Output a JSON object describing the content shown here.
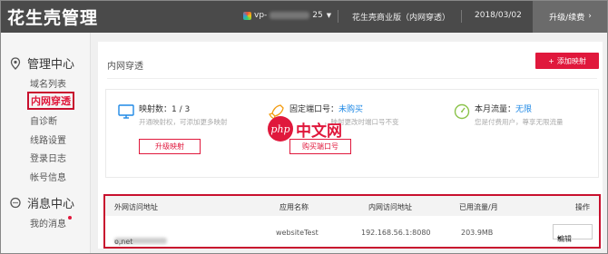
{
  "app": {
    "title": "花生壳管理"
  },
  "topbar": {
    "host_prefix": "vp-",
    "host_suffix": "25",
    "edition": "花生壳商业版（内网穿透）",
    "date": "2018/03/02",
    "renew_label": "升级/续费"
  },
  "sidebar": {
    "sections": [
      {
        "title": "管理中心",
        "items": [
          "域名列表",
          "内网穿透",
          "自诊断",
          "线路设置",
          "登录日志",
          "帐号信息"
        ]
      },
      {
        "title": "消息中心",
        "items": [
          "我的消息"
        ]
      }
    ],
    "active_item": "内网穿透"
  },
  "main": {
    "title": "内网穿透",
    "add_label": "添加映射",
    "cards": [
      {
        "label": "映射数：",
        "value": "1 / 3",
        "desc": "开通映射权，可添加更多映射",
        "button": "升级映射"
      },
      {
        "label": "固定端口号：",
        "value": "未购买",
        "desc": "，映射更改时端口号不变",
        "button": "购买端口号"
      },
      {
        "label": "本月流量：",
        "value": "无限",
        "desc": "您是付费用户，尊享无限流量"
      }
    ],
    "table": {
      "columns": [
        "外网访问地址",
        "应用名称",
        "内网访问地址",
        "已用流量/月",
        "操作"
      ],
      "rows": [
        {
          "address_prefix": "vp-",
          "address_suffix": "o.net",
          "app": "websiteTest",
          "lan": "192.168.56.1:8080",
          "traffic": "203.9MB",
          "action": "编辑"
        }
      ]
    }
  },
  "watermark": {
    "circle_text": "php",
    "text": "中文网"
  },
  "colors": {
    "accent": "#e0183c",
    "topbar": "#4a4a4a",
    "link": "#1e88e5"
  }
}
